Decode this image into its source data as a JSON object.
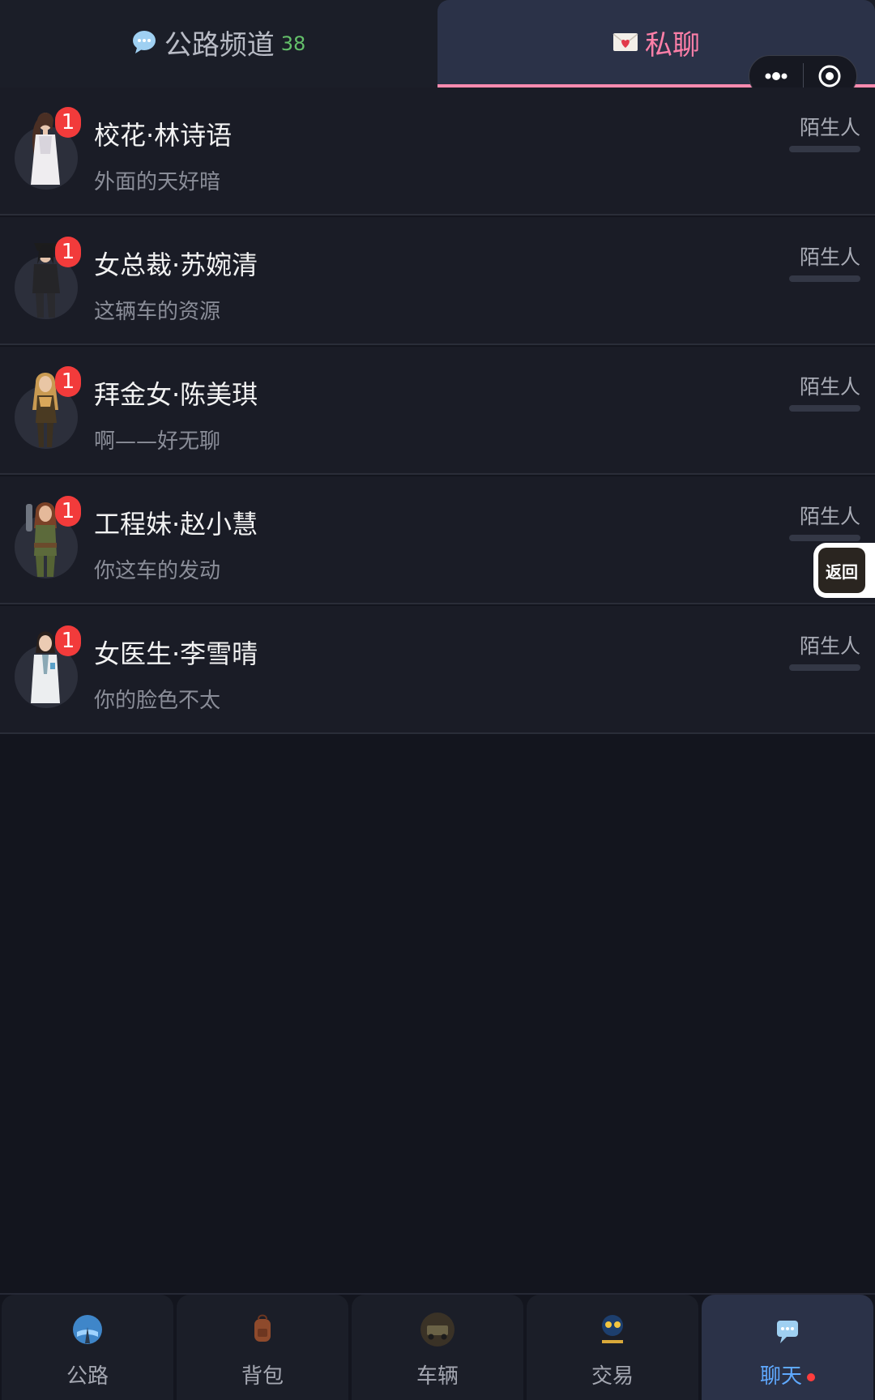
{
  "tabs": {
    "public": {
      "label": "公路频道",
      "count": "38"
    },
    "private": {
      "label": "私聊"
    }
  },
  "chats": [
    {
      "name": "校花·林诗语",
      "preview": "外面的天好暗",
      "unread": "1",
      "relation": "陌生人"
    },
    {
      "name": "女总裁·苏婉清",
      "preview": "这辆车的资源",
      "unread": "1",
      "relation": "陌生人"
    },
    {
      "name": "拜金女·陈美琪",
      "preview": "啊——好无聊",
      "unread": "1",
      "relation": "陌生人"
    },
    {
      "name": "工程妹·赵小慧",
      "preview": "你这车的发动",
      "unread": "1",
      "relation": "陌生人"
    },
    {
      "name": "女医生·李雪晴",
      "preview": "你的脸色不太",
      "unread": "1",
      "relation": "陌生人"
    }
  ],
  "back_button": {
    "label": "返回"
  },
  "bottom_nav": [
    {
      "label": "公路",
      "icon": "road-globe-icon"
    },
    {
      "label": "背包",
      "icon": "backpack-icon"
    },
    {
      "label": "车辆",
      "icon": "vehicle-icon"
    },
    {
      "label": "交易",
      "icon": "trade-icon"
    },
    {
      "label": "聊天",
      "icon": "chat-bubble-icon",
      "active": true
    }
  ],
  "colors": {
    "background": "#13151e",
    "active_tab": "#2b3248",
    "private_accent": "#ff7fa8",
    "count_green": "#64c06a",
    "badge_red": "#f23b3b",
    "nav_active_text": "#5fa9ff"
  }
}
